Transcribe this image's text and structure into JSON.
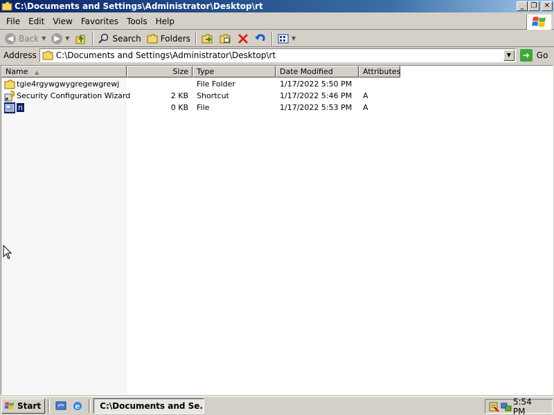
{
  "window": {
    "title": "C:\\Documents and Settings\\Administrator\\Desktop\\rt",
    "buttons": {
      "minimize": "_",
      "restore": "❐",
      "close": "✕"
    }
  },
  "menu": {
    "items": [
      {
        "label": "File",
        "underline": "F"
      },
      {
        "label": "Edit",
        "underline": "E"
      },
      {
        "label": "View",
        "underline": "V"
      },
      {
        "label": "Favorites",
        "underline": "a"
      },
      {
        "label": "Tools",
        "underline": "T"
      },
      {
        "label": "Help",
        "underline": "H"
      }
    ]
  },
  "toolbar": {
    "back_label": "Back",
    "search_label": "Search",
    "folders_label": "Folders"
  },
  "address": {
    "label": "Address",
    "value": "C:\\Documents and Settings\\Administrator\\Desktop\\rt",
    "go_label": "Go"
  },
  "columns": {
    "name": "Name",
    "size": "Size",
    "type": "Type",
    "date": "Date Modified",
    "attributes": "Attributes"
  },
  "files": [
    {
      "name": "tgie4rgywgwygregewgrewj",
      "size": "",
      "type": "File Folder",
      "date": "1/17/2022 5:50 PM",
      "attributes": "",
      "icon": "folder-icon",
      "selected": false
    },
    {
      "name": "Security Configuration Wizard",
      "size": "2 KB",
      "type": "Shortcut",
      "date": "1/17/2022 5:46 PM",
      "attributes": "A",
      "icon": "shortcut-icon",
      "selected": false
    },
    {
      "name": "n",
      "size": "0 KB",
      "type": "File",
      "date": "1/17/2022 5:53 PM",
      "attributes": "A",
      "icon": "file-icon",
      "selected": true
    }
  ],
  "taskbar": {
    "start_label": "Start",
    "task_label": "C:\\Documents and Se...",
    "clock": "5:54 PM"
  },
  "colors": {
    "title_bar": "#0a246a",
    "selection": "#0a246a",
    "chrome": "#d4d0c8"
  }
}
